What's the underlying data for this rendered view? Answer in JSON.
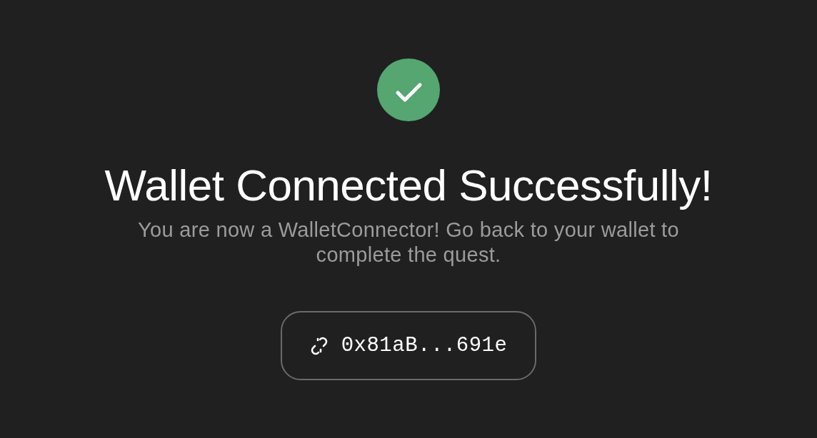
{
  "status": {
    "kind": "success"
  },
  "title": "Wallet Connected Successfully!",
  "message": "You are now a WalletConnector! Go back to your wallet to complete the quest.",
  "wallet_button": {
    "label": "0x81aB...691e"
  }
}
